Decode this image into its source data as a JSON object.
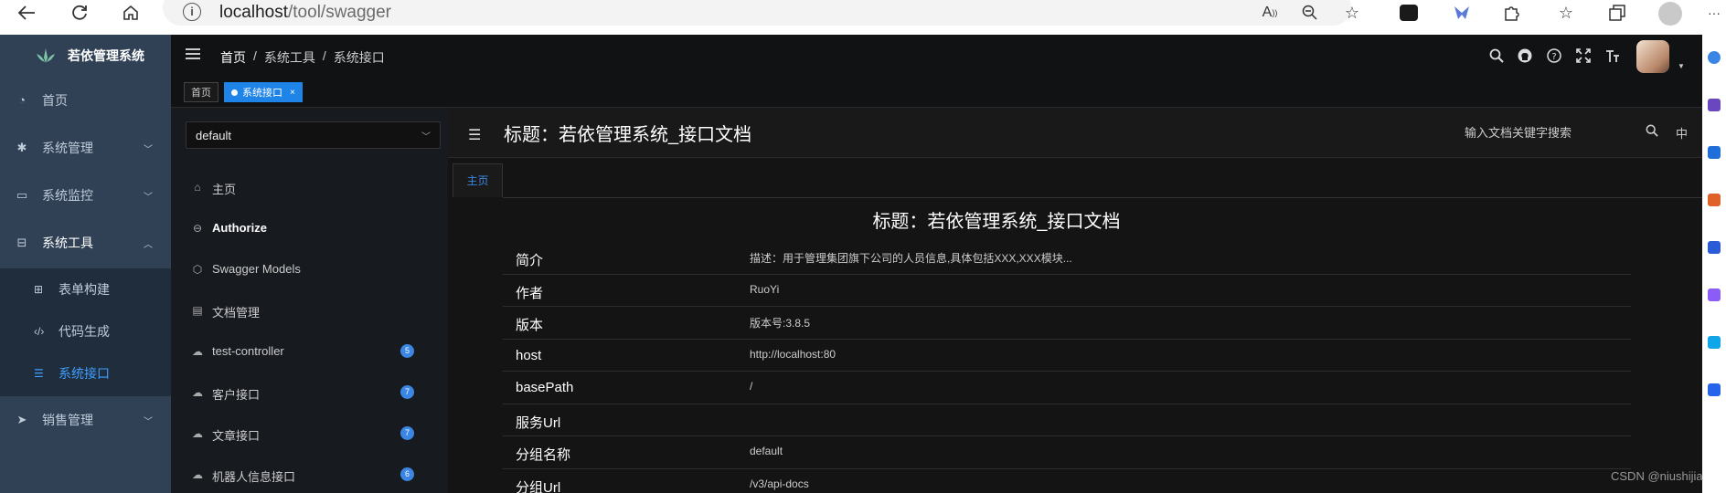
{
  "browser": {
    "url_host": "localhost",
    "url_path": "/tool/swagger",
    "more": "···"
  },
  "sidebar": {
    "logo_title": "若依管理系统",
    "items": [
      {
        "label": "首页",
        "icon": "dashboard-icon"
      },
      {
        "label": "系统管理",
        "icon": "gear-icon"
      },
      {
        "label": "系统监控",
        "icon": "monitor-icon"
      },
      {
        "label": "系统工具",
        "icon": "toolbox-icon"
      },
      {
        "label": "销售管理",
        "icon": "send-icon"
      }
    ],
    "subitems": [
      {
        "label": "表单构建",
        "icon": "grid-icon"
      },
      {
        "label": "代码生成",
        "icon": "code-icon"
      },
      {
        "label": "系统接口",
        "icon": "list-icon"
      }
    ],
    "accent_color": "#409eff",
    "bg_color": "#304156"
  },
  "navbar": {
    "breadcrumb": [
      "首页",
      "系统工具",
      "系统接口"
    ],
    "separator": "/"
  },
  "tags": [
    {
      "label": "首页"
    },
    {
      "label": "系统接口",
      "close": "×"
    }
  ],
  "docnav": {
    "group": "default",
    "items": [
      {
        "label": "主页",
        "icon": "home-icon"
      },
      {
        "label": "Authorize",
        "icon": "lock-icon"
      },
      {
        "label": "Swagger Models",
        "icon": "cube-icon"
      },
      {
        "label": "文档管理",
        "icon": "document-icon"
      },
      {
        "label": "test-controller",
        "icon": "cloud-icon",
        "badge": "5"
      },
      {
        "label": "客户接口",
        "icon": "cloud-icon",
        "badge": "7"
      },
      {
        "label": "文章接口",
        "icon": "cloud-icon",
        "badge": "7"
      },
      {
        "label": "机器人信息接口",
        "icon": "cloud-icon",
        "badge": "6"
      }
    ]
  },
  "doc": {
    "header_title": "标题：若依管理系统_接口文档",
    "search_placeholder": "输入文档关键字搜索",
    "lang": "中",
    "home_tab": "主页",
    "content_title": "标题：若依管理系统_接口文档",
    "rows": [
      {
        "key": "简介",
        "value": "描述：用于管理集团旗下公司的人员信息,具体包括XXX,XXX模块..."
      },
      {
        "key": "作者",
        "value": "RuoYi"
      },
      {
        "key": "版本",
        "value": "版本号:3.8.5"
      },
      {
        "key": "host",
        "value": "http://localhost:80"
      },
      {
        "key": "basePath",
        "value": "/"
      },
      {
        "key": "服务Url",
        "value": ""
      },
      {
        "key": "分组名称",
        "value": "default"
      },
      {
        "key": "分组Url",
        "value": "/v3/api-docs"
      }
    ]
  },
  "watermark": "CSDN @niushijia"
}
